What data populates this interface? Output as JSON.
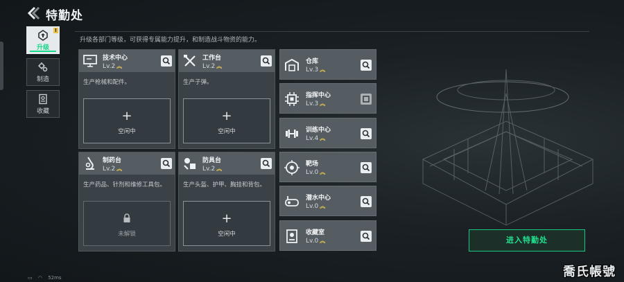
{
  "header": {
    "title": "特勤处",
    "subtitle": "升级各部门等级，可获得专属能力提升，和制造战斗物资的能力。"
  },
  "tabs": [
    {
      "label": "升级",
      "icon": "upgrade-icon",
      "active": true,
      "alert": "!"
    },
    {
      "label": "制造",
      "icon": "gears-icon",
      "active": false
    },
    {
      "label": "收藏",
      "icon": "collection-icon",
      "active": false
    }
  ],
  "facilities": [
    {
      "name": "技术中心",
      "level": "Lv.2",
      "icon": "monitor-icon",
      "desc": "生产枪械和配件。",
      "slot": "空闲中"
    },
    {
      "name": "工作台",
      "level": "Lv.2",
      "icon": "tools-icon",
      "desc": "生产子弹。",
      "slot": "空闲中"
    },
    {
      "name": "制药台",
      "level": "Lv.2",
      "icon": "microscope-icon",
      "desc": "生产药品、针剂和维修工具包。",
      "slot": "未解锁"
    },
    {
      "name": "防具台",
      "level": "Lv.2",
      "icon": "armor-icon",
      "desc": "生产头盔、护甲、胸挂和背包。",
      "slot": "空闲中"
    }
  ],
  "small_facilities": [
    {
      "name": "仓库",
      "level": "Lv.3",
      "icon": "warehouse-icon"
    },
    {
      "name": "指挥中心",
      "level": "Lv.3",
      "icon": "chip-icon"
    },
    {
      "name": "训练中心",
      "level": "Lv.4",
      "icon": "dumbbell-icon"
    },
    {
      "name": "靶场",
      "level": "Lv.0",
      "icon": "target-icon"
    },
    {
      "name": "潜水中心",
      "level": "Lv.0",
      "icon": "diving-icon"
    },
    {
      "name": "收藏室",
      "level": "Lv.0",
      "icon": "display-icon"
    }
  ],
  "enter_button": "进入特勤处",
  "status": {
    "ping": "52ms"
  },
  "watermark": "喬氏帳號",
  "colors": {
    "accent": "#18d88a",
    "level_chevron": "#e8c24a"
  }
}
